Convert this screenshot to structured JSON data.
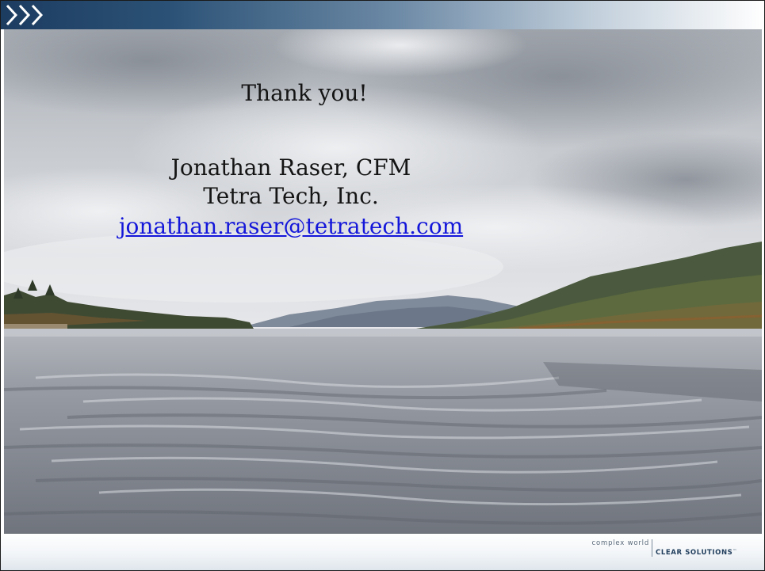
{
  "slide": {
    "thanks": "Thank you!",
    "contact": {
      "name": "Jonathan Raser, CFM",
      "company": "Tetra Tech, Inc.",
      "email": "jonathan.raser@tetratech.com"
    }
  },
  "footer": {
    "tagline_left": "complex world",
    "tagline_right": "CLEAR SOLUTIONS",
    "trademark": "™"
  },
  "colors": {
    "header_dark": "#1c3c60",
    "link": "#1417d9",
    "text": "#141414"
  },
  "icons": {
    "header": "chevron-arrows-icon"
  }
}
